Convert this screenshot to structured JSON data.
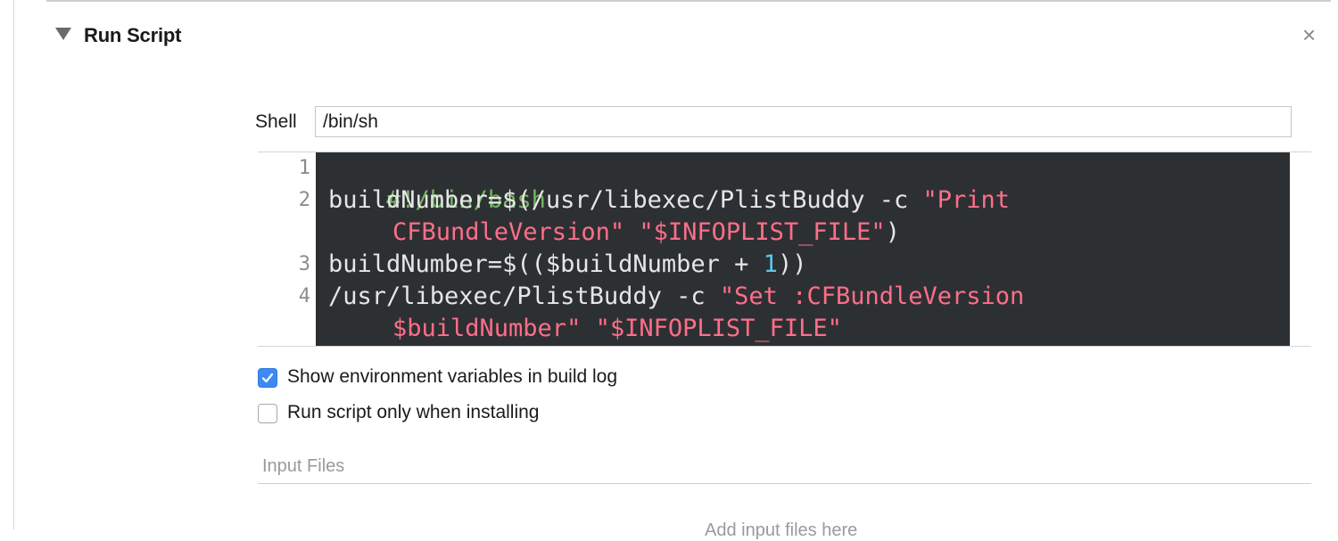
{
  "phase": {
    "title": "Run Script",
    "disclosure_icon": "triangle-down-icon",
    "close_glyph": "×"
  },
  "shell": {
    "label": "Shell",
    "value": "/bin/sh"
  },
  "script": {
    "line_numbers": [
      "1",
      "2",
      "3",
      "4"
    ],
    "lines": [
      {
        "segments": [
          {
            "type": "comment",
            "text": "#!/bin/bash"
          }
        ]
      },
      {
        "segments": [
          {
            "type": "plain",
            "text": "buildNumber=$(/usr/libexec/PlistBuddy -c "
          },
          {
            "type": "string",
            "text": "\"Print"
          }
        ]
      },
      {
        "segments": [
          {
            "type": "string",
            "text": "CFBundleVersion\" \"$INFOPLIST_FILE\""
          },
          {
            "type": "plain",
            "text": ")"
          }
        ]
      },
      {
        "segments": [
          {
            "type": "plain",
            "text": "buildNumber=$(($buildNumber + "
          },
          {
            "type": "number",
            "text": "1"
          },
          {
            "type": "plain",
            "text": "))"
          }
        ]
      },
      {
        "segments": [
          {
            "type": "plain",
            "text": "/usr/libexec/PlistBuddy -c "
          },
          {
            "type": "string",
            "text": "\"Set :CFBundleVersion"
          }
        ]
      },
      {
        "segments": [
          {
            "type": "string",
            "text": "$buildNumber\" \"$INFOPLIST_FILE\""
          }
        ]
      }
    ]
  },
  "options": {
    "show_env": {
      "label": "Show environment variables in build log",
      "checked": true
    },
    "install_only": {
      "label": "Run script only when installing",
      "checked": false
    }
  },
  "input_files": {
    "label": "Input Files",
    "partial_placeholder": "Add input files here"
  },
  "colors": {
    "code_background": "#2d3032",
    "comment": "#73b362",
    "string": "#ff6e8a",
    "number": "#5fc6e8",
    "plain": "#e6e6e6",
    "checkbox_accent": "#3d8bf0"
  }
}
